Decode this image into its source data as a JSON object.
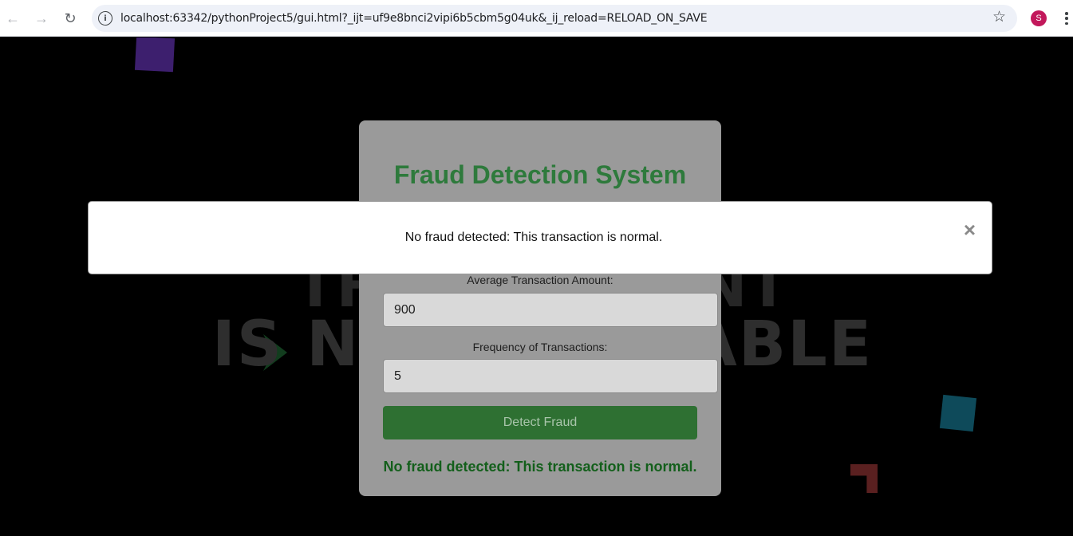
{
  "browser": {
    "url": "localhost:63342/pythonProject5/gui.html?_ijt=uf9e8bnci2vipi6b5cbm5g04uk&_ij_reload=RELOAD_ON_SAVE",
    "back_glyph": "←",
    "forward_glyph": "→",
    "reload_glyph": "↻",
    "info_glyph": "i",
    "star_glyph": "☆",
    "profile_initial": "S"
  },
  "background": {
    "line1": "THIS CONTENT",
    "line2": "IS NOT AVAILABLE"
  },
  "form": {
    "title": "Fraud Detection System",
    "avg_amount_label": "Average Transaction Amount:",
    "avg_amount_value": "900",
    "frequency_label": "Frequency of Transactions:",
    "frequency_value": "5",
    "detect_button": "Detect Fraud",
    "result": "No fraud detected: This transaction is normal."
  },
  "modal": {
    "message": "No fraud detected: This transaction is normal.",
    "close_glyph": "×"
  },
  "colors": {
    "title_green": "#2e7a3c",
    "button_green": "#2e7032",
    "result_green": "#135f1b",
    "avatar": "#c2185b"
  }
}
